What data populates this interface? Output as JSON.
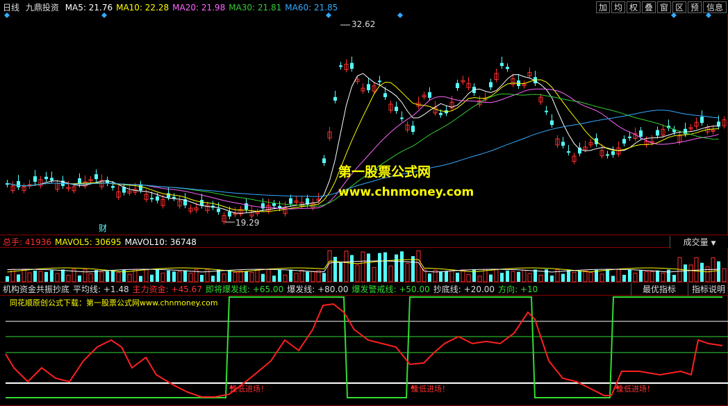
{
  "header": {
    "period": "日线",
    "stock_name": "九鼎投资",
    "ma": [
      {
        "label": "MA5: 21.76",
        "color": "#ffffff"
      },
      {
        "label": "MA10: 22.28",
        "color": "#ffff00"
      },
      {
        "label": "MA20: 21.98",
        "color": "#ff66ff"
      },
      {
        "label": "MA30: 21.81",
        "color": "#33cc33"
      },
      {
        "label": "MA60: 21.85",
        "color": "#33aaff"
      }
    ]
  },
  "toolbar": [
    "加",
    "均",
    "权",
    "叠",
    "窗",
    "区",
    "预",
    "信息"
  ],
  "price_chart": {
    "high_label": "32.62",
    "low_label": "19.29",
    "finance_marker": "财"
  },
  "watermark": {
    "line1": "第一股票公式网",
    "line2": "www.chnmoney.com"
  },
  "volume": {
    "items": [
      {
        "label": "总手: 41936",
        "color": "#ff3030"
      },
      {
        "label": "MAVOL5: 30695",
        "color": "#ffff00"
      },
      {
        "label": "MAVOL10: 36748",
        "color": "#ffffff"
      }
    ],
    "dropdown": "成交量"
  },
  "indicator": {
    "items": [
      {
        "label": "机构资金共振抄底",
        "color": "#dddddd"
      },
      {
        "label": "平均线: +1.48",
        "color": "#dddddd"
      },
      {
        "label": "主力资金: +45.67",
        "color": "#ff3030"
      },
      {
        "label": "即将爆发线: +65.00",
        "color": "#33dd33"
      },
      {
        "label": "爆发线: +80.00",
        "color": "#dddddd"
      },
      {
        "label": "爆发警戒线: +50.00",
        "color": "#33dd33"
      },
      {
        "label": "抄底线: +20.00",
        "color": "#dddddd"
      },
      {
        "label": "方向: +10",
        "color": "#33dd33"
      }
    ],
    "best_button": "最优指标",
    "explain_button": "指标说明",
    "promo": "同花顺原创公式下载：第一股票公式网www.chnmoney.com",
    "signal_text": "逢低进场！"
  },
  "colors": {
    "up": "#ff3030",
    "down": "#54ffff",
    "ma5": "#ffffff",
    "ma10": "#ffff00",
    "ma20": "#ff66ff",
    "ma30": "#33cc33",
    "ma60": "#33aaff",
    "main_fund": "#ff2020",
    "direction": "#33dd33"
  }
}
